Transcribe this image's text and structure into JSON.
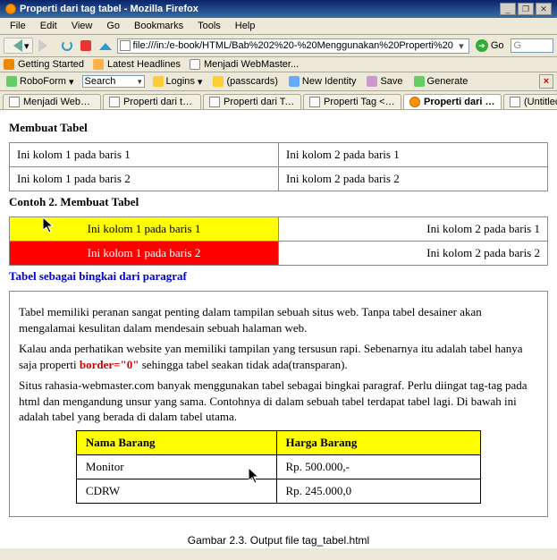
{
  "window": {
    "title": "Properti dari tag tabel - Mozilla Firefox"
  },
  "menu": [
    "File",
    "Edit",
    "View",
    "Go",
    "Bookmarks",
    "Tools",
    "Help"
  ],
  "address_url": "file:///in:/e-book/HTML/Bab%202%20-%20Menggunakan%20Properti%20",
  "go_label": "Go",
  "bookmarks": {
    "getting_started": "Getting Started",
    "latest_headlines": "Latest Headlines",
    "menjadi_web": "Menjadi WebMaster..."
  },
  "roboform": {
    "label": "RoboForm",
    "search": "Search",
    "logins": "Logins",
    "passcards": "(passcards)",
    "new_identity": "New Identity",
    "save": "Save",
    "generate": "Generate"
  },
  "tabs": [
    {
      "label": "Menjadi WebMas..."
    },
    {
      "label": "Properti dari tag A"
    },
    {
      "label": "Properti dari Tag ..."
    },
    {
      "label": "Properti Tag <p>"
    },
    {
      "label": "Properti dari ta...",
      "active": true
    },
    {
      "label": "(Untitled)"
    }
  ],
  "page": {
    "h1": "Membuat Tabel",
    "t1": {
      "r1c1": "Ini kolom 1 pada baris 1",
      "r1c2": "Ini kolom 2 pada baris 1",
      "r2c1": "Ini kolom 1 pada baris 2",
      "r2c2": "Ini kolom 2 pada baris 2"
    },
    "h2": "Contoh 2. Membuat Tabel",
    "t2": {
      "r1c1": "Ini kolom 1 pada baris 1",
      "r1c2": "Ini kolom 2 pada baris 1",
      "r2c1": "Ini kolom 1 pada baris 2",
      "r2c2": "Ini kolom 2 pada baris 2"
    },
    "h3": "Tabel sebagai bingkai dari paragraf",
    "p1": "Tabel memiliki peranan sangat penting dalam tampilan sebuah situs web. Tanpa tabel desainer akan mengalamai kesulitan dalam mendesain sebuah halaman web.",
    "p2a": "Kalau anda perhatikan website yan memiliki tampilan yang tersusun rapi. Sebenarnya itu adalah tabel hanya saja properti ",
    "p2b": "border=\"0\"",
    "p2c": " sehingga tabel seakan tidak ada(transparan).",
    "p3": "Situs rahasia-webmaster.com banyak menggunakan tabel sebagai bingkai paragraf. Perlu diingat tag-tag pada html dan mengandung unsur yang sama. Contohnya di dalam sebuah tabel terdapat tabel lagi. Di bawah ini adalah tabel yang berada di dalam tabel utama.",
    "t3": {
      "h1": "Nama Barang",
      "h2": "Harga Barang",
      "r1c1": "Monitor",
      "r1c2": "Rp. 500.000,-",
      "r2c1": "CDRW",
      "r2c2": "Rp. 245.000,0"
    }
  },
  "caption": "Gambar 2.3. Output file tag_tabel.html"
}
